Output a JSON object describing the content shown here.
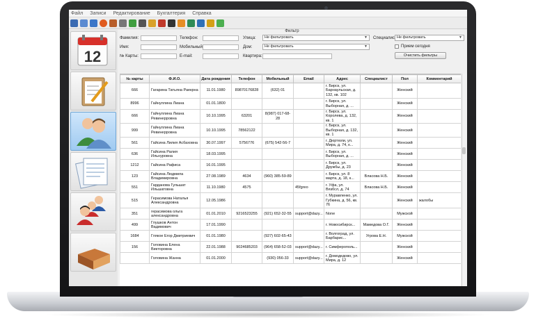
{
  "menu": [
    "Файл",
    "Записи",
    "Редактирование",
    "Бухгалтерия",
    "Справка"
  ],
  "toolbar_icons": [
    {
      "name": "home-icon",
      "color": "#3b6bb2"
    },
    {
      "name": "calendar-icon",
      "color": "#5a8ad1"
    },
    {
      "name": "save-icon",
      "color": "#3c77c8"
    },
    {
      "name": "stop-icon",
      "color": "#e05a1e"
    },
    {
      "name": "house-icon",
      "color": "#b85e2a"
    },
    {
      "name": "pin-icon",
      "color": "#777777"
    },
    {
      "name": "picture-icon",
      "color": "#3f9e3f"
    },
    {
      "name": "gear-icon",
      "color": "#555555"
    },
    {
      "name": "edit-icon",
      "color": "#d9a12b"
    },
    {
      "name": "book-icon",
      "color": "#c0392b"
    },
    {
      "name": "film-icon",
      "color": "#333333"
    },
    {
      "name": "gift-icon",
      "color": "#e58e26"
    },
    {
      "name": "basket-icon",
      "color": "#2e8b57"
    },
    {
      "name": "user-icon",
      "color": "#2f70b7"
    },
    {
      "name": "coins-icon",
      "color": "#d4a017"
    },
    {
      "name": "chat-icon",
      "color": "#4caf50"
    }
  ],
  "filter": {
    "title": "Фильтр",
    "surname": "Фамилия:",
    "phone": "Телефон:",
    "street": "Улица:",
    "specialist": "Специалист:",
    "name": "Имя:",
    "mobile": "Мобильный:",
    "house": "Дом:",
    "today": "Прием сегодня",
    "card": "№ Карты:",
    "email": "E-mail:",
    "flat": "Квартира:",
    "no_filter": "Не фильтровать",
    "clear_button": "Очистить фильтры"
  },
  "columns": [
    "№ карты",
    "Ф.И.О.",
    "Дата рождения",
    "Телефон",
    "Мобильный",
    "Email",
    "Адрес",
    "Специалист",
    "Пол",
    "Комментарий"
  ],
  "rows": [
    {
      "card": "666",
      "fio": "Гагарина Татьяна Раекрна",
      "birth": "11.01.1980",
      "phone": "89870176828",
      "mobile": "(632) 01",
      "email": "",
      "address": "г. Бирск, ул. Барнаульская, д. 132, кв. 102",
      "specialist": "",
      "sex": "Женский",
      "comment": ""
    },
    {
      "card": "8996",
      "fio": "Гайнуллина Лиана",
      "birth": "01.01.1800",
      "phone": "",
      "mobile": "",
      "email": "",
      "address": "г. Бирск, ул. Выборная, д. ...",
      "specialist": "",
      "sex": "Женский",
      "comment": ""
    },
    {
      "card": "666",
      "fio": "Гайнуллина Лиана Ревинерровна",
      "birth": "10.10.1995",
      "phone": "63201",
      "mobile": "8(987) 017-68-28",
      "email": "",
      "address": "г. Бирск, ул. Королева, д. 132, кв. 1",
      "specialist": "",
      "sex": "Женский",
      "comment": ""
    },
    {
      "card": "999",
      "fio": "Гайнуллина Лиана Ревинерровна",
      "birth": "10.10.1995",
      "phone": "78562122",
      "mobile": "",
      "email": "",
      "address": "г. Бирск, ул. Выборная, д. 132, кв. 1",
      "specialist": "",
      "sex": "Женский",
      "comment": ""
    },
    {
      "card": "561",
      "fio": "Гайсина Лилия Асбаховна",
      "birth": "30.07.1997",
      "phone": "5756776",
      "mobile": "(675) 542-56-7",
      "email": "",
      "address": "г. Дюртюли, ул. Мира, д. 74, к...",
      "specialist": "",
      "sex": "Женский",
      "comment": ""
    },
    {
      "card": "636",
      "fio": "Гайсина Ралия Ильнуровна",
      "birth": "18.03.1995",
      "phone": "",
      "mobile": "",
      "email": "",
      "address": "г. Бирск, ул. Выборная, д. ...",
      "specialist": "",
      "sex": "Женский",
      "comment": ""
    },
    {
      "card": "1212",
      "fio": "Гайсина Рафиса",
      "birth": "16.01.1995",
      "phone": "",
      "mobile": "",
      "email": "",
      "address": "г. Бирск, ул. Дружбы, д. 23",
      "specialist": "",
      "sex": "Женский",
      "comment": ""
    },
    {
      "card": "123",
      "fio": "Гайсина Людмила Владимировна",
      "birth": "27.08.1989",
      "phone": "4634",
      "mobile": "(960) 385-59-89",
      "email": "",
      "address": "г. Бирск, ул. 8 марта, д. 18, к...",
      "specialist": "Власова Н.Б.",
      "sex": "Женский",
      "comment": ""
    },
    {
      "card": "551",
      "fio": "Гарданова Гульшат Ильшатовна",
      "birth": "11.10.1980",
      "phone": "4575",
      "mobile": "",
      "email": "45fgreo",
      "address": "г. Уфа, ул. Вязбсл, д. 74",
      "specialist": "Власова Н.Б.",
      "sex": "Женский",
      "comment": ""
    },
    {
      "card": "515",
      "fio": "Герасимова Наталья Александровна",
      "birth": "12.05.1986",
      "phone": "",
      "mobile": "",
      "email": "",
      "address": "г. Муравленко, ул. Губкина, д. 56, кв. 76",
      "specialist": "",
      "sex": "Женский",
      "comment": "жалобы"
    },
    {
      "card": "351",
      "fio": "герасимова ольга александровна",
      "birth": "01.01.2010",
      "phone": "9216523255",
      "mobile": "(921) 652-32-55",
      "email": "support@dazy...",
      "address": "None",
      "specialist": "",
      "sex": "Мужской",
      "comment": ""
    },
    {
      "card": "499",
      "fio": "Глушков Антон Вадимович",
      "birth": "17.01.1990",
      "phone": "",
      "mobile": "",
      "email": "",
      "address": "г. Новосибирск...",
      "specialist": "Мамедова О.Г.",
      "sex": "Женский",
      "comment": ""
    },
    {
      "card": "1684",
      "fio": "Глякое Егор Дмитриевич",
      "birth": "01.01.1980",
      "phone": "",
      "mobile": "(927) 602-65-43",
      "email": "",
      "address": "г. Волгоград, ул. Барбарис...",
      "specialist": "Угрова Е.Н.",
      "sex": "Мужской",
      "comment": ""
    },
    {
      "card": "156",
      "fio": "Головина Елена Викторовна",
      "birth": "22.01.1988",
      "phone": "9024685203",
      "mobile": "(964) 658-52-03",
      "email": "support@dazy...",
      "address": "г. Симферополь...",
      "specialist": "",
      "sex": "Женский",
      "comment": ""
    },
    {
      "card": "",
      "fio": "Головина Жанна",
      "birth": "01.01.2000",
      "phone": "",
      "mobile": "(930) 056-33",
      "email": "support@dazy...",
      "address": "г. Домодедово, ул. Мира, д. 12",
      "specialist": "",
      "sex": "Женский",
      "comment": ""
    }
  ],
  "calendar_day": "12"
}
